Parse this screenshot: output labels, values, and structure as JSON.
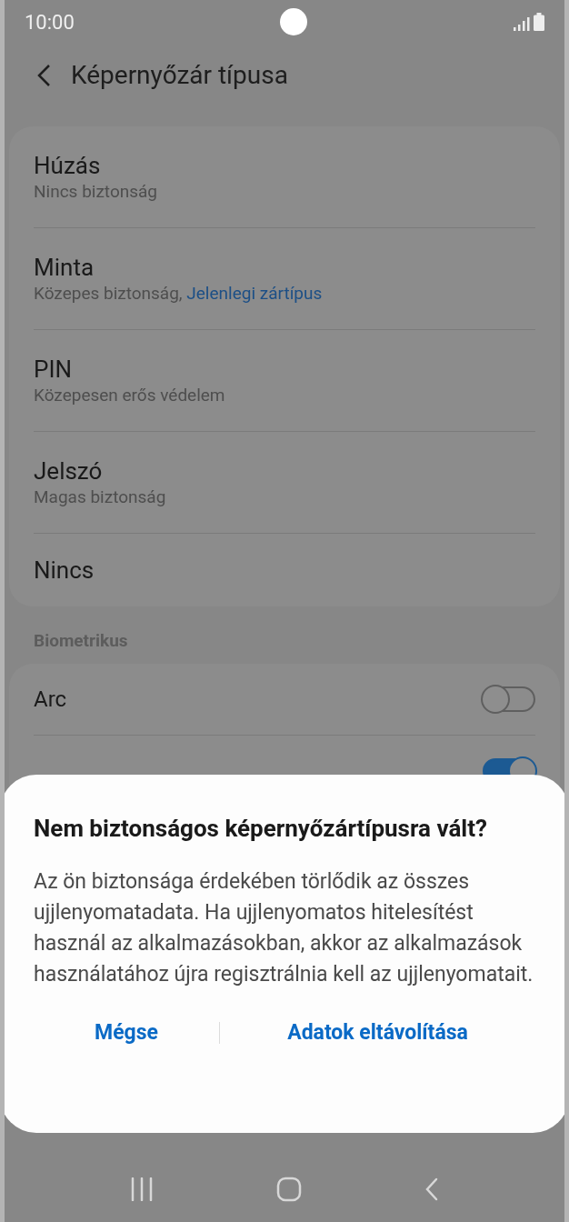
{
  "status_bar": {
    "time": "10:00"
  },
  "header": {
    "title": "Képernyőzár típusa"
  },
  "lock_types": [
    {
      "title": "Húzás",
      "subtitle": "Nincs biztonság"
    },
    {
      "title": "Minta",
      "subtitle": "Közepes biztonság, ",
      "current": "Jelenlegi zártípus"
    },
    {
      "title": "PIN",
      "subtitle": "Közepesen erős védelem"
    },
    {
      "title": "Jelszó",
      "subtitle": "Magas biztonság"
    },
    {
      "title": "Nincs"
    }
  ],
  "biometrics": {
    "heading": "Biometrikus",
    "items": [
      {
        "title": "Arc",
        "on": false
      },
      {
        "on": true
      }
    ]
  },
  "dialog": {
    "title": "Nem biztonságos képernyőzártípusra vált?",
    "message": "Az ön biztonsága érdekében törlődik az összes ujjlenyomatadata. Ha ujjlenyomatos hitelesítést használ az alkalmazásokban, akkor az alkalmazások használatához újra regisztrálnia kell az ujjlenyomatait.",
    "buttons": [
      "Mégse",
      "Adatok eltávolítása"
    ]
  }
}
